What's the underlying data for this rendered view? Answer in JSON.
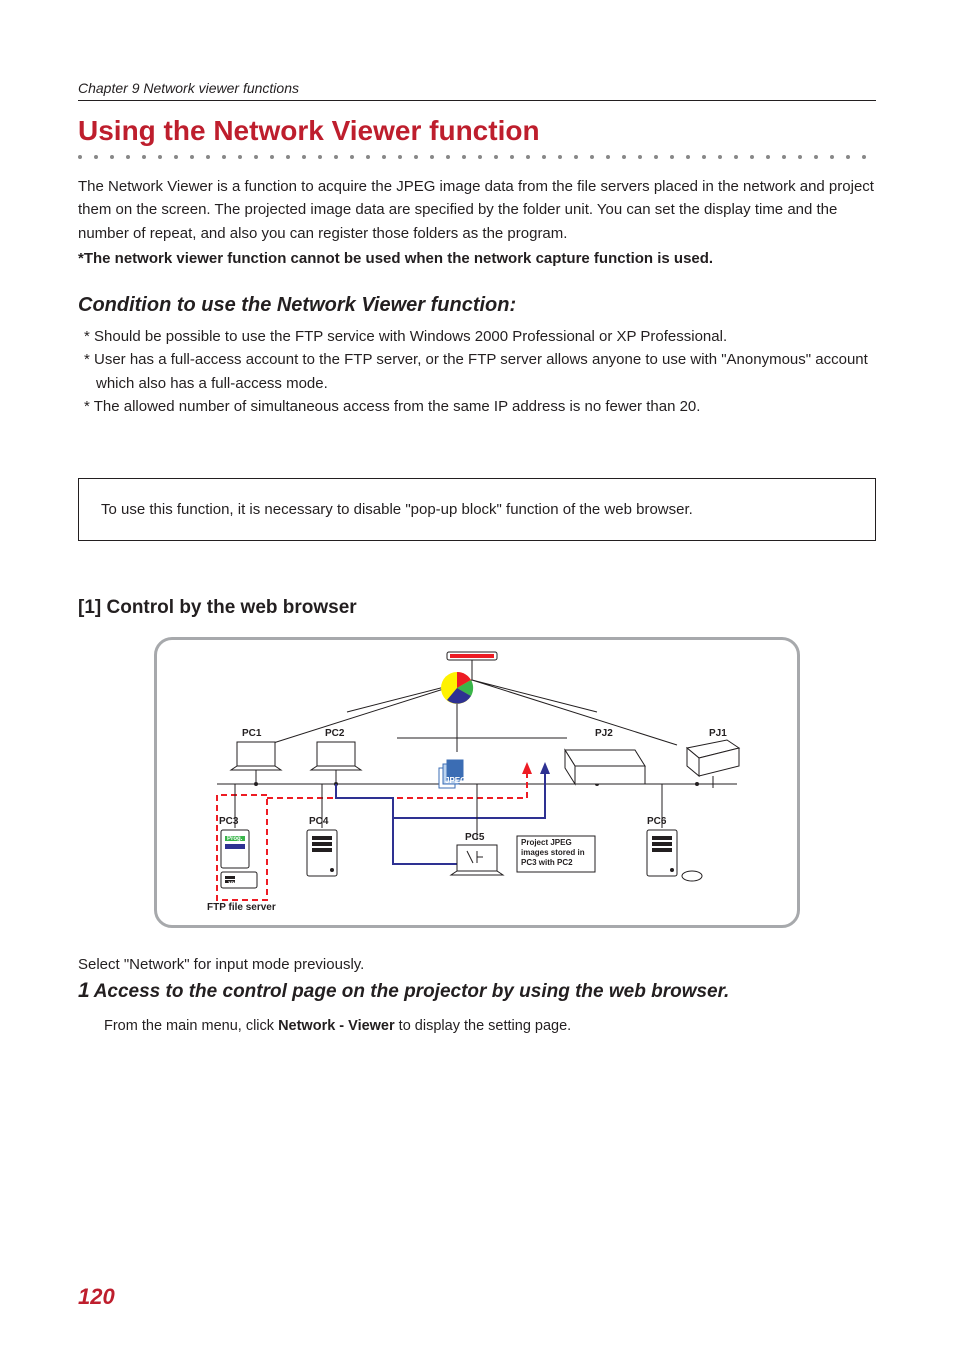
{
  "chapter": "Chapter 9 Network viewer functions",
  "heading": "Using the Network Viewer function",
  "intro_p1": "The Network Viewer is a function to acquire the JPEG image data from the file servers placed in the network and project them on the screen. The projected image data are specified by the folder unit. You can set the display time and the number of repeat, and also you can register those folders as the program.",
  "intro_bold": "*The network viewer function cannot be used when the network capture function is used.",
  "condition": {
    "heading": "Condition to use the Network Viewer function:",
    "items": [
      "* Should be possible to use the FTP service with Windows 2000 Professional or XP Professional.",
      "* User has a full-access account to the FTP server, or the FTP server allows anyone to use with \"Anonymous\" account which also has a full-access mode.",
      "* The allowed number of simultaneous access from the same IP address is no fewer than 20."
    ]
  },
  "note": "To use this function, it is necessary to disable \"pop-up block\" function of the web browser.",
  "section": "[1] Control by the web browser",
  "diagram": {
    "pc1": "PC1",
    "pc2": "PC2",
    "pj2": "PJ2",
    "pj1": "PJ1",
    "pc3": "PC3",
    "pc4": "PC4",
    "pc5": "PC5",
    "pc6": "PC6",
    "ftp_label": "FTP file server",
    "callout_label1": "Project JPEG",
    "callout_label2": "images stored in",
    "callout_label3": "PC3 with PC2",
    "jpeg": "JPEG",
    "prog": "Prog."
  },
  "after_diagram": "Select \"Network\" for input mode previously.",
  "step1": "Access to the control page on the projector by using the web browser.",
  "step1_sub_pre": "From the main menu, click ",
  "step1_sub_bold": "Network - Viewer",
  "step1_sub_post": " to display the setting page.",
  "page_number": "120"
}
